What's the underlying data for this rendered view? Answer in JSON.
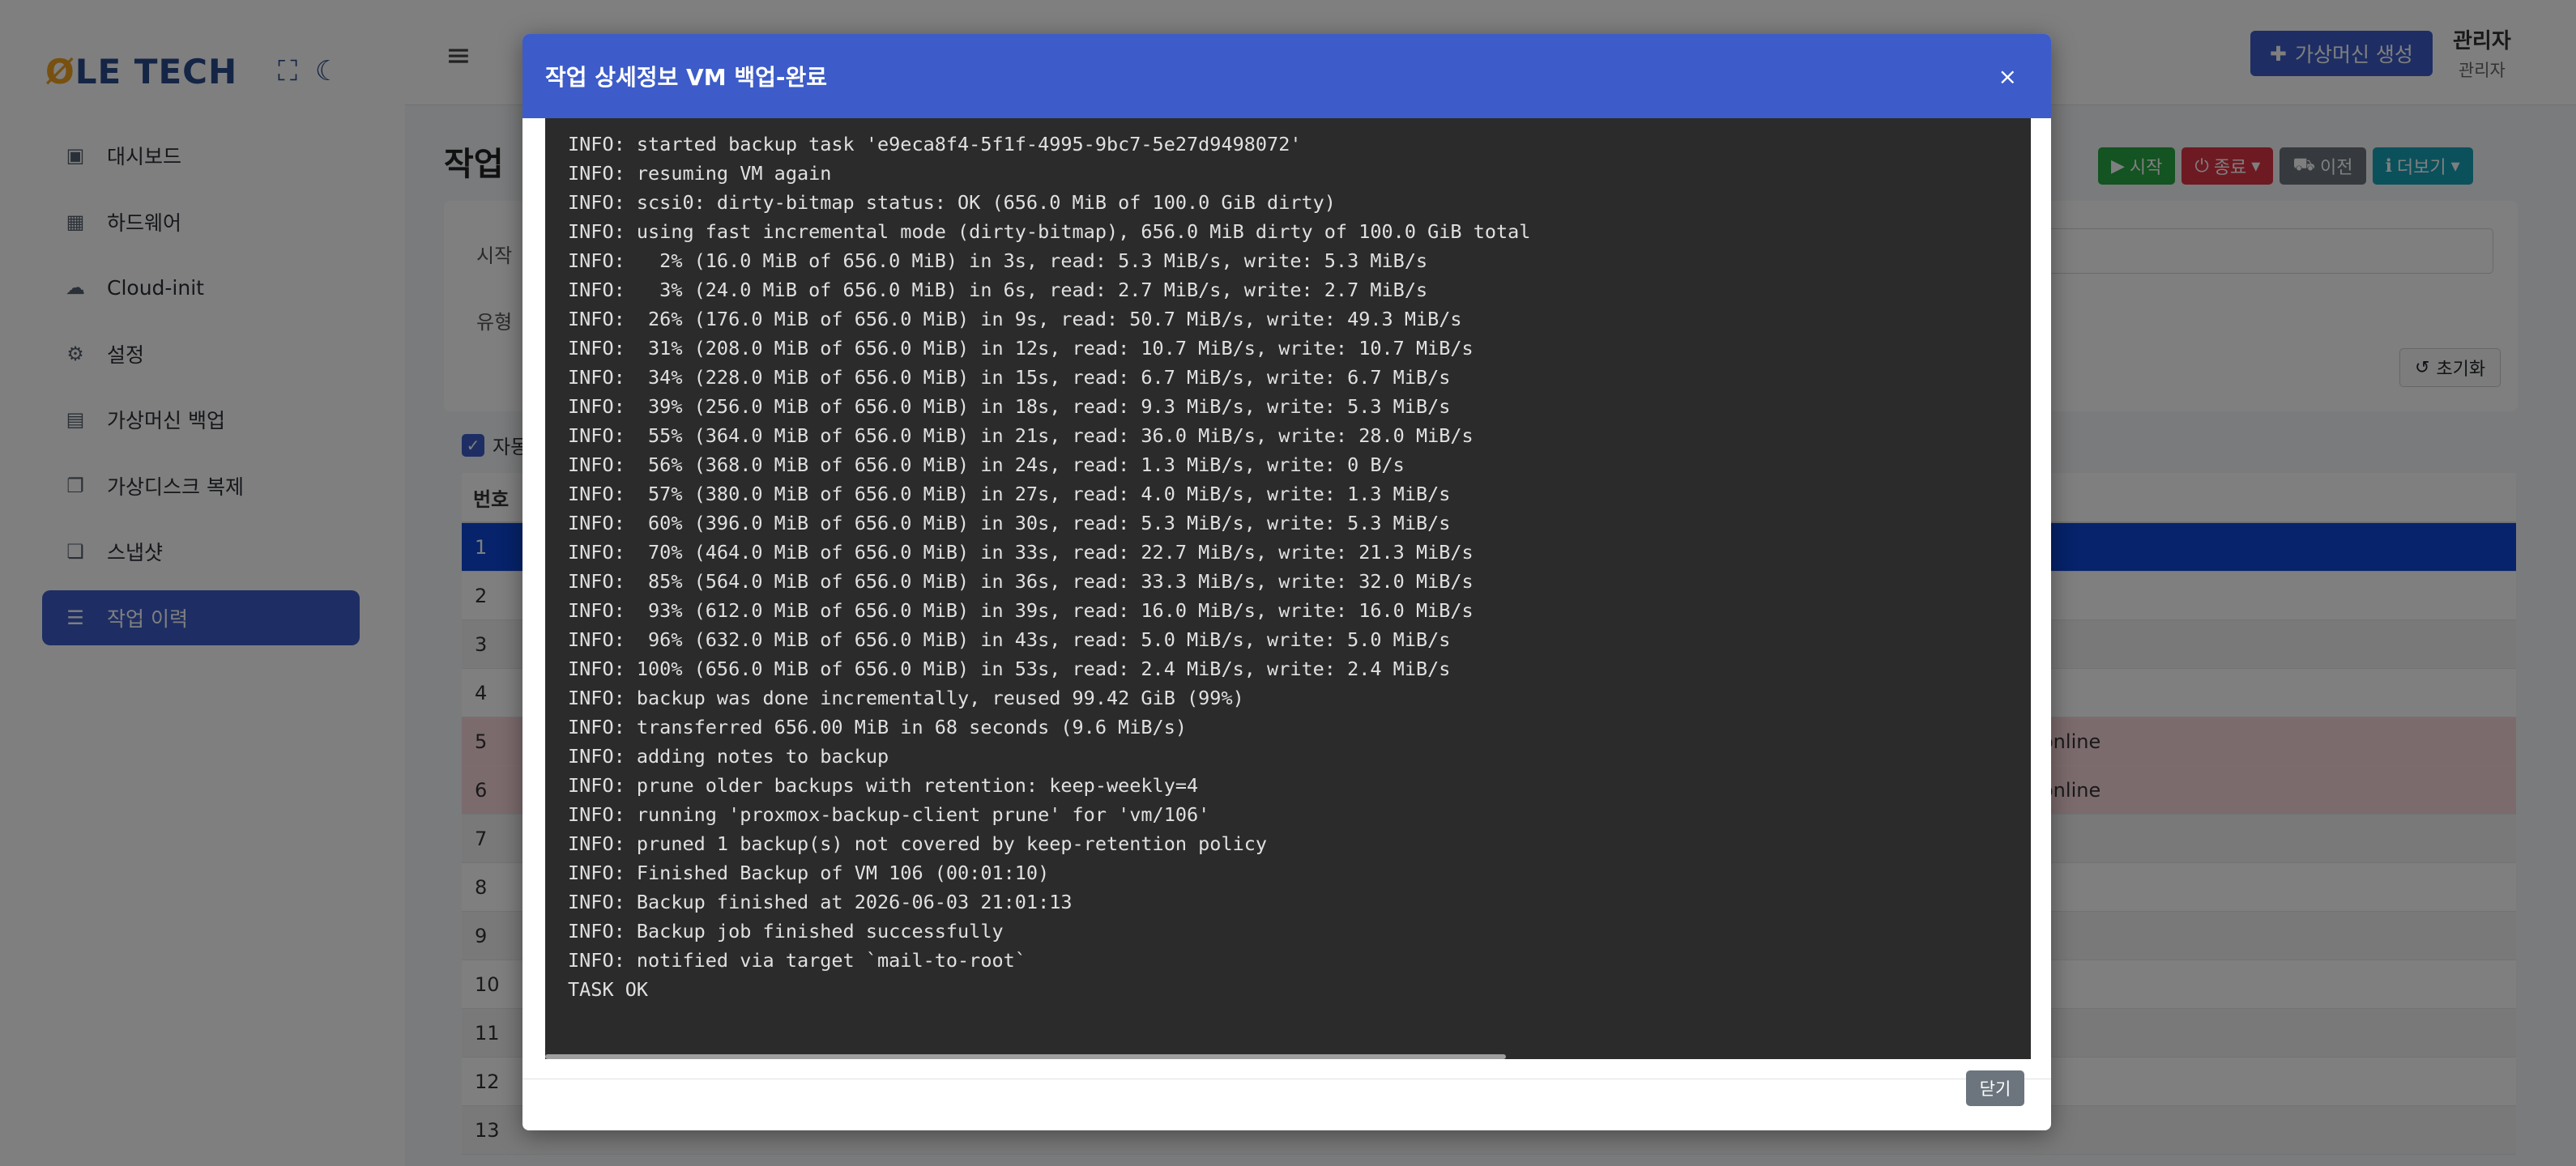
{
  "sidebar": {
    "logo_o": "Ø",
    "logo_rest": "LE TECH",
    "icons": [
      "fullscreen-icon",
      "moon-icon"
    ],
    "items": [
      {
        "label": "대시보드",
        "icon": "dashboard-icon"
      },
      {
        "label": "하드웨어",
        "icon": "chip-icon"
      },
      {
        "label": "Cloud-init",
        "icon": "cloud-icon"
      },
      {
        "label": "설정",
        "icon": "gear-icon"
      },
      {
        "label": "가상머신 백업",
        "icon": "save-icon"
      },
      {
        "label": "가상디스크 복제",
        "icon": "copy-icon"
      },
      {
        "label": "스냅샷",
        "icon": "snapshot-icon"
      },
      {
        "label": "작업 이력",
        "icon": "list-icon",
        "active": true
      }
    ]
  },
  "topbar": {
    "create_label": "가상머신 생성",
    "user_name": "관리자",
    "user_role": "관리자"
  },
  "main": {
    "title": "작업",
    "actions": {
      "start": "시작",
      "stop": "종료",
      "migrate": "이전",
      "more": "더보기"
    },
    "filters": {
      "start_label": "시작",
      "type_label": "유형",
      "reset": "초기화"
    },
    "auto_label": "자동",
    "table_header": "번호",
    "rows": [
      "1",
      "2",
      "3",
      "4",
      "5",
      "6",
      "7",
      "8",
      "9",
      "10",
      "11",
      "12",
      "13"
    ],
    "status_text": "online"
  },
  "modal": {
    "title": "작업 상세정보 VM 백업-완료",
    "close_x": "×",
    "close_button": "닫기",
    "log_lines": [
      "INFO: started backup task 'e9eca8f4-5f1f-4995-9bc7-5e27d9498072'",
      "INFO: resuming VM again",
      "INFO: scsi0: dirty-bitmap status: OK (656.0 MiB of 100.0 GiB dirty)",
      "INFO: using fast incremental mode (dirty-bitmap), 656.0 MiB dirty of 100.0 GiB total",
      "INFO:   2% (16.0 MiB of 656.0 MiB) in 3s, read: 5.3 MiB/s, write: 5.3 MiB/s",
      "INFO:   3% (24.0 MiB of 656.0 MiB) in 6s, read: 2.7 MiB/s, write: 2.7 MiB/s",
      "INFO:  26% (176.0 MiB of 656.0 MiB) in 9s, read: 50.7 MiB/s, write: 49.3 MiB/s",
      "INFO:  31% (208.0 MiB of 656.0 MiB) in 12s, read: 10.7 MiB/s, write: 10.7 MiB/s",
      "INFO:  34% (228.0 MiB of 656.0 MiB) in 15s, read: 6.7 MiB/s, write: 6.7 MiB/s",
      "INFO:  39% (256.0 MiB of 656.0 MiB) in 18s, read: 9.3 MiB/s, write: 5.3 MiB/s",
      "INFO:  55% (364.0 MiB of 656.0 MiB) in 21s, read: 36.0 MiB/s, write: 28.0 MiB/s",
      "INFO:  56% (368.0 MiB of 656.0 MiB) in 24s, read: 1.3 MiB/s, write: 0 B/s",
      "INFO:  57% (380.0 MiB of 656.0 MiB) in 27s, read: 4.0 MiB/s, write: 1.3 MiB/s",
      "INFO:  60% (396.0 MiB of 656.0 MiB) in 30s, read: 5.3 MiB/s, write: 5.3 MiB/s",
      "INFO:  70% (464.0 MiB of 656.0 MiB) in 33s, read: 22.7 MiB/s, write: 21.3 MiB/s",
      "INFO:  85% (564.0 MiB of 656.0 MiB) in 36s, read: 33.3 MiB/s, write: 32.0 MiB/s",
      "INFO:  93% (612.0 MiB of 656.0 MiB) in 39s, read: 16.0 MiB/s, write: 16.0 MiB/s",
      "INFO:  96% (632.0 MiB of 656.0 MiB) in 43s, read: 5.0 MiB/s, write: 5.0 MiB/s",
      "INFO: 100% (656.0 MiB of 656.0 MiB) in 53s, read: 2.4 MiB/s, write: 2.4 MiB/s",
      "INFO: backup was done incrementally, reused 99.42 GiB (99%)",
      "INFO: transferred 656.00 MiB in 68 seconds (9.6 MiB/s)",
      "INFO: adding notes to backup",
      "INFO: prune older backups with retention: keep-weekly=4",
      "INFO: running 'proxmox-backup-client prune' for 'vm/106'",
      "INFO: pruned 1 backup(s) not covered by keep-retention policy",
      "INFO: Finished Backup of VM 106 (00:01:10)",
      "INFO: Backup finished at 2026-06-03 21:01:13",
      "INFO: Backup job finished successfully",
      "INFO: notified via target `mail-to-root`",
      "TASK OK"
    ]
  }
}
